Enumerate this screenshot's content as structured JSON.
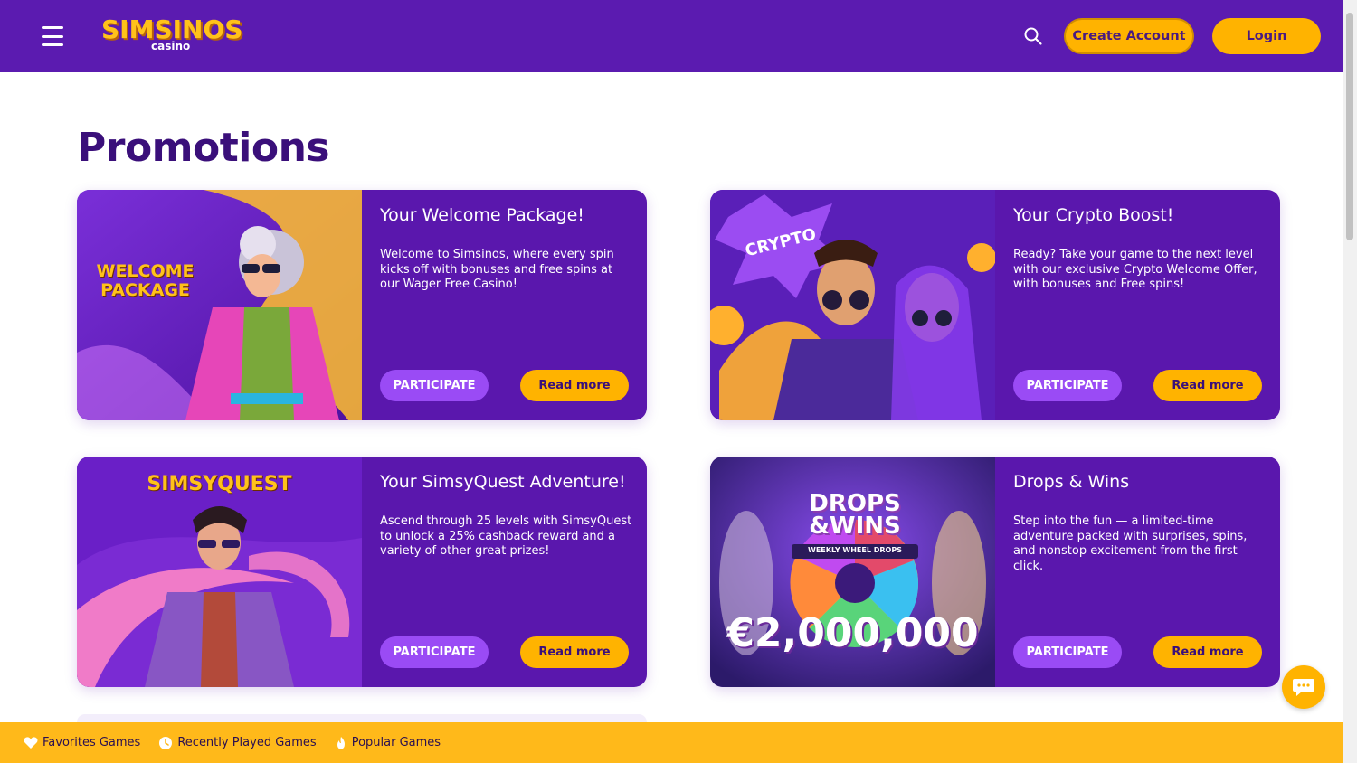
{
  "header": {
    "logo_main": "SIMSINOS",
    "logo_sub": "casino",
    "create_account": "Create Account",
    "login": "Login"
  },
  "page_title": "Promotions",
  "promotions": [
    {
      "title": "Your Welcome Package!",
      "description": "Welcome to Simsinos, where every spin kicks off with bonuses and free spins at our Wager Free Casino!",
      "image_text": "WELCOME PACKAGE",
      "participate": "PARTICIPATE",
      "read_more": "Read more"
    },
    {
      "title": "Your Crypto Boost!",
      "description": "Ready? Take your game to the next level with our exclusive Crypto Welcome Offer, with bonuses and Free spins!",
      "image_text": "CRYPTO",
      "participate": "PARTICIPATE",
      "read_more": "Read more"
    },
    {
      "title": "Your SimsyQuest Adventure!",
      "description": "Ascend through 25 levels with SimsyQuest to unlock a 25% cashback reward and a variety of other great prizes!",
      "image_text": "SIMSYQUEST",
      "participate": "PARTICIPATE",
      "read_more": "Read more"
    },
    {
      "title": "Drops & Wins",
      "description": "Step into the fun — a limited-time adventure packed with surprises, spins, and nonstop excitement from the first click.",
      "image_text": "DROPS &WINS",
      "image_subtext": "WEEKLY WHEEL DROPS",
      "image_amount": "€2,000,000",
      "participate": "PARTICIPATE",
      "read_more": "Read more"
    }
  ],
  "bottom_bar": {
    "favorites": "Favorites Games",
    "recent": "Recently Played Games",
    "popular": "Popular Games"
  },
  "colors": {
    "brand_purple": "#5b1bb0",
    "card_purple": "#5a17ad",
    "accent_yellow": "#ffb300",
    "participate_purple": "#9a4bf5",
    "title_purple": "#3a0f7a"
  },
  "icons": [
    "hamburger-menu-icon",
    "search-icon",
    "chat-icon",
    "heart-icon",
    "clock-icon",
    "fire-icon"
  ]
}
